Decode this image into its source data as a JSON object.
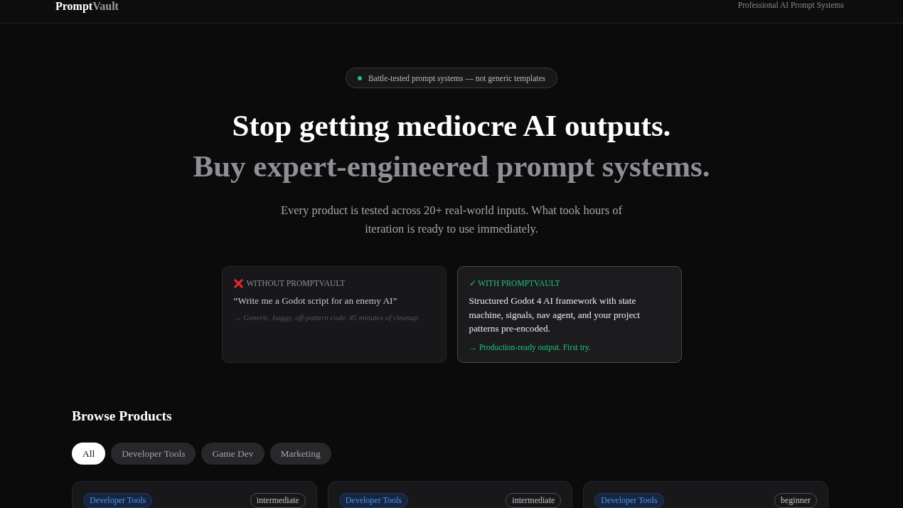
{
  "header": {
    "logo": "**Prompt**Vault",
    "tagline": "Professional AI Prompt Systems"
  },
  "hero": {
    "badge": "Battle-tested prompt systems — not generic templates",
    "headline": "Stop getting mediocre AI outputs.",
    "subheadline": "Buy expert-engineered prompt systems.",
    "description": "Every product is tested across 20+ real-world inputs. What took hours of iteration is ready to use immediately."
  },
  "comparison": [
    {
      "kind": "without",
      "label": "WITHOUT PROMPTVAULT",
      "body": "“Write me a Godot script for an enemy AI”",
      "outcome": "→ Generic, buggy, off-pattern code. 45 minutes of cleanup."
    },
    {
      "kind": "with",
      "label": "✓ WITH PROMPTVAULT",
      "body": "Structured Godot 4 AI framework with state machine, signals, nav agent, and your project patterns pre-encoded.",
      "outcome": "→ Production-ready output. First try."
    }
  ],
  "browse": {
    "title": "Browse Products",
    "filters": [
      {
        "label": "All",
        "selected": true
      },
      {
        "label": "Developer Tools",
        "selected": false
      },
      {
        "label": "Game Dev",
        "selected": false
      },
      {
        "label": "Marketing",
        "selected": false
      }
    ],
    "products": [
      {
        "category": "Developer Tools",
        "difficulty": "intermediate"
      },
      {
        "category": "Developer Tools",
        "difficulty": "intermediate"
      },
      {
        "category": "Developer Tools",
        "difficulty": "beginner"
      }
    ]
  }
}
